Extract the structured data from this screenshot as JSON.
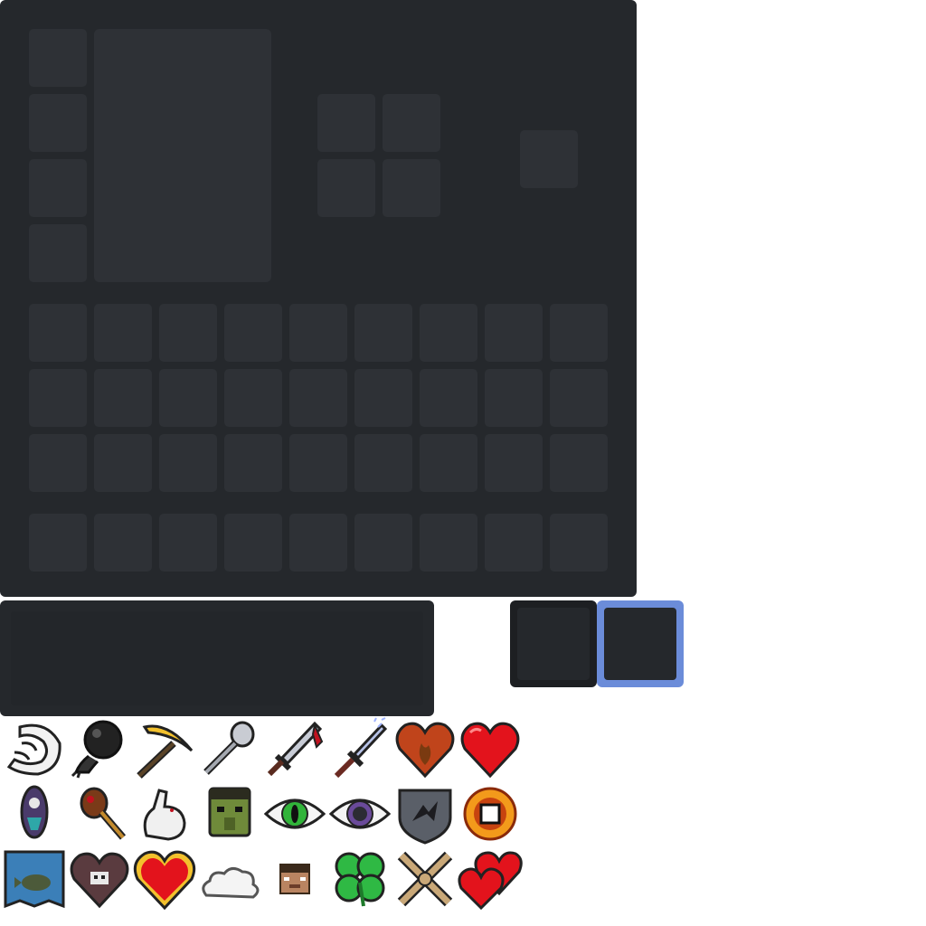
{
  "colors": {
    "panel": "#25282c",
    "slot": "#2e3136",
    "selected_border": "#6b8cd9",
    "button_border": "#1d1f22"
  },
  "inventory": {
    "armor_slots": 4,
    "crafting_grid": "2x2",
    "result_slots": 1,
    "storage_rows": 3,
    "hotbar_slots": 9
  },
  "search": {
    "value": ""
  },
  "tab_buttons": [
    {
      "name": "inventory-tab",
      "selected": false
    },
    {
      "name": "selected-tab",
      "selected": true
    }
  ],
  "icons": [
    [
      "white-claw-icon",
      "bomb-ball-icon",
      "golden-pickaxe-icon",
      "iron-spoon-icon",
      "bloody-sword-icon",
      "magic-dagger-icon",
      "burning-heart-icon",
      "red-heart-icon"
    ],
    [
      "spirit-totem-icon",
      "meat-club-icon",
      "white-rabbit-icon",
      "zombie-head-icon",
      "green-eye-icon",
      "dark-eye-icon",
      "dragon-shield-icon",
      "fire-ring-icon"
    ],
    [
      "fish-banner-icon",
      "skeleton-heart-icon",
      "golden-heart-icon",
      "cloud-icon",
      "steve-head-icon",
      "four-leaf-clover-icon",
      "crossed-bones-icon",
      "double-heart-icon"
    ]
  ]
}
